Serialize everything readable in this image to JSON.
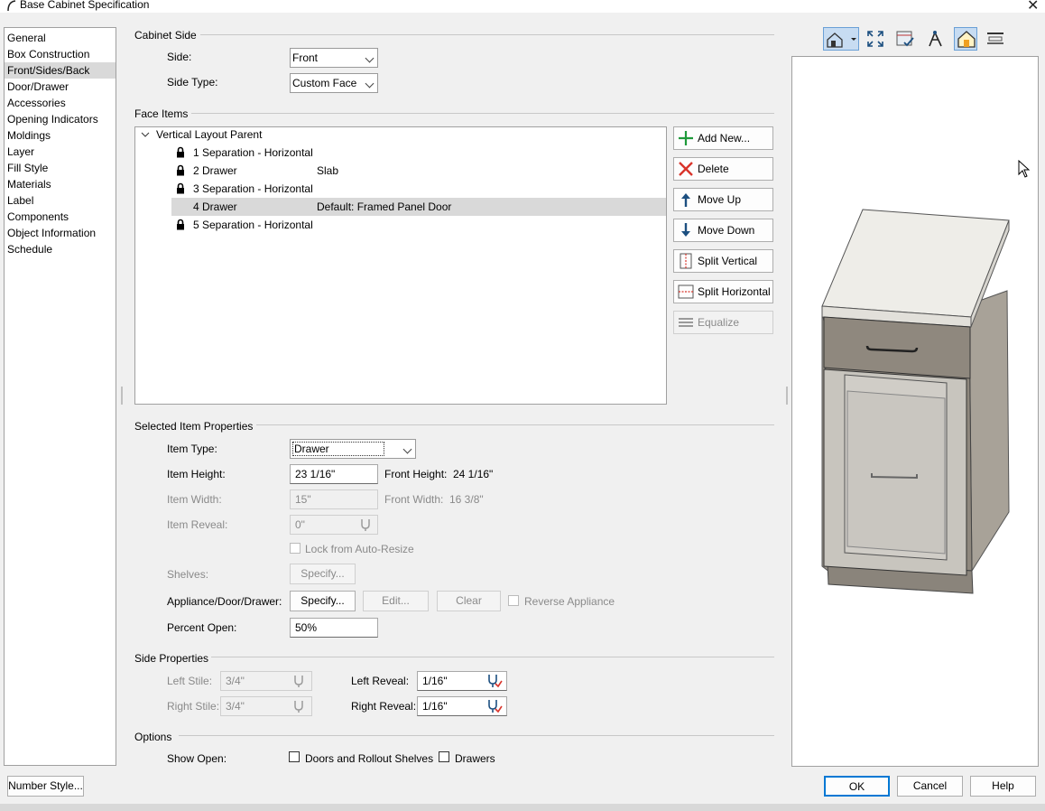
{
  "window": {
    "title": "Base Cabinet Specification"
  },
  "sidebar": {
    "items": [
      {
        "label": "General"
      },
      {
        "label": "Box Construction"
      },
      {
        "label": "Front/Sides/Back"
      },
      {
        "label": "Door/Drawer"
      },
      {
        "label": "Accessories"
      },
      {
        "label": "Opening Indicators"
      },
      {
        "label": "Moldings"
      },
      {
        "label": "Layer"
      },
      {
        "label": "Fill Style"
      },
      {
        "label": "Materials"
      },
      {
        "label": "Label"
      },
      {
        "label": "Components"
      },
      {
        "label": "Object Information"
      },
      {
        "label": "Schedule"
      }
    ],
    "selected": "Front/Sides/Back"
  },
  "cabinet_side": {
    "heading": "Cabinet Side",
    "side_label": "Side:",
    "side_value": "Front",
    "side_type_label": "Side Type:",
    "side_type_value": "Custom Face"
  },
  "face_items": {
    "heading": "Face Items",
    "root": "Vertical Layout Parent",
    "rows": [
      {
        "name": "1 Separation - Horizontal",
        "desc": "",
        "locked": true
      },
      {
        "name": "2 Drawer",
        "desc": "Slab",
        "locked": true
      },
      {
        "name": "3 Separation - Horizontal",
        "desc": "",
        "locked": true
      },
      {
        "name": "4 Drawer",
        "desc": "Default: Framed Panel Door",
        "locked": false
      },
      {
        "name": "5 Separation - Horizontal",
        "desc": "",
        "locked": true
      }
    ],
    "buttons": {
      "add_new": "Add New...",
      "delete": "Delete",
      "move_up": "Move Up",
      "move_down": "Move Down",
      "split_vertical": "Split Vertical",
      "split_horizontal": "Split Horizontal",
      "equalize": "Equalize"
    }
  },
  "selected_item": {
    "heading": "Selected Item Properties",
    "item_type_label": "Item Type:",
    "item_type_value": "Drawer",
    "item_height_label": "Item Height:",
    "item_height_value": "23 1/16\"",
    "front_height_label": "Front Height:",
    "front_height_value": "24 1/16\"",
    "item_width_label": "Item Width:",
    "item_width_value": "15\"",
    "front_width_label": "Front Width:",
    "front_width_value": "16 3/8\"",
    "item_reveal_label": "Item Reveal:",
    "item_reveal_value": "0\"",
    "lock_label": "Lock from Auto-Resize",
    "shelves_label": "Shelves:",
    "shelves_button": "Specify...",
    "appliance_label": "Appliance/Door/Drawer:",
    "appliance_specify": "Specify...",
    "appliance_edit": "Edit...",
    "appliance_clear": "Clear",
    "reverse_appliance": "Reverse Appliance",
    "percent_open_label": "Percent Open:",
    "percent_open_value": "50%"
  },
  "side_properties": {
    "heading": "Side Properties",
    "left_stile_label": "Left Stile:",
    "left_stile_value": "3/4\"",
    "right_stile_label": "Right Stile:",
    "right_stile_value": "3/4\"",
    "left_reveal_label": "Left Reveal:",
    "left_reveal_value": "1/16\"",
    "right_reveal_label": "Right Reveal:",
    "right_reveal_value": "1/16\""
  },
  "options": {
    "heading": "Options",
    "show_open_label": "Show Open:",
    "doors_label": "Doors and Rollout Shelves",
    "drawers_label": "Drawers"
  },
  "footer": {
    "number_style": "Number Style...",
    "ok": "OK",
    "cancel": "Cancel",
    "help": "Help"
  },
  "toolbar": {
    "icons": [
      "camera-view-icon",
      "fill-window-icon",
      "render-options-icon",
      "wireframe-icon",
      "glass-house-icon",
      "toolbar-menu-icon"
    ]
  },
  "colors": {
    "selection": "#d9d9d9",
    "ok_border": "#0078d4",
    "toolbar_active": "#c7dcf2"
  }
}
